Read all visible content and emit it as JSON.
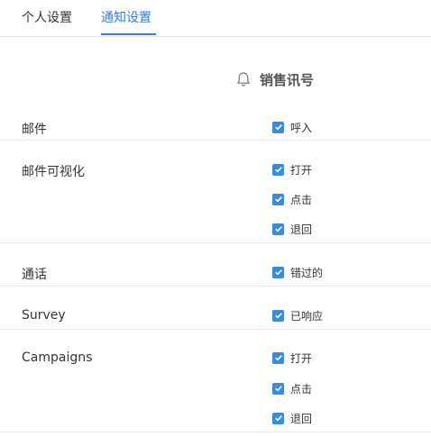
{
  "tabs": [
    {
      "label": "个人设置",
      "active": false
    },
    {
      "label": "通知设置",
      "active": true
    }
  ],
  "colors": {
    "accent": "#3a7bc8",
    "checkbox": "#3b8bd9"
  },
  "section": {
    "icon": "bell-icon",
    "title": "销售讯号"
  },
  "rows": [
    {
      "label": "邮件",
      "options": [
        {
          "label": "呼入",
          "checked": true
        }
      ]
    },
    {
      "label": "邮件可视化",
      "options": [
        {
          "label": "打开",
          "checked": true
        },
        {
          "label": "点击",
          "checked": true
        },
        {
          "label": "退回",
          "checked": true
        }
      ]
    },
    {
      "label": "通话",
      "options": [
        {
          "label": "错过的",
          "checked": true
        }
      ]
    },
    {
      "label": "Survey",
      "options": [
        {
          "label": "已响应",
          "checked": true
        }
      ]
    },
    {
      "label": "Campaigns",
      "options": [
        {
          "label": "打开",
          "checked": true
        },
        {
          "label": "点击",
          "checked": true
        },
        {
          "label": "退回",
          "checked": true
        }
      ]
    }
  ]
}
